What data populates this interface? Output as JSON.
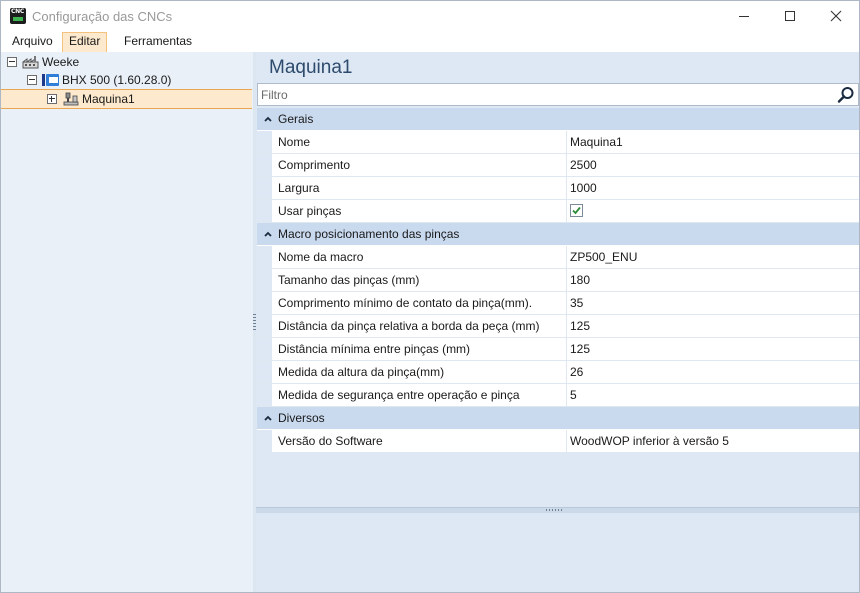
{
  "window": {
    "title": "Configuração das CNCs",
    "app_icon_text": "CNC"
  },
  "menu": {
    "items": [
      "Arquivo",
      "Editar",
      "Ferramentas"
    ],
    "active": "Editar"
  },
  "tree": {
    "nodes": [
      {
        "label": "Weeke",
        "expander": "minus"
      },
      {
        "label": "BHX 500 (1.60.28.0)",
        "expander": "minus"
      },
      {
        "label": "Maquina1",
        "expander": "plus",
        "selected": true
      }
    ]
  },
  "panel": {
    "title": "Maquina1",
    "filter_placeholder": "Filtro",
    "categories": [
      {
        "label": "Gerais",
        "props": [
          {
            "name": "Nome",
            "value": "Maquina1"
          },
          {
            "name": "Comprimento",
            "value": "2500"
          },
          {
            "name": "Largura",
            "value": "1000"
          },
          {
            "name": "Usar pinças",
            "value": "",
            "checked": true
          }
        ]
      },
      {
        "label": "Macro posicionamento das pinças",
        "props": [
          {
            "name": "Nome da macro",
            "value": "ZP500_ENU"
          },
          {
            "name": "Tamanho das pinças (mm)",
            "value": "180"
          },
          {
            "name": "Comprimento mínimo de contato da pinça(mm).",
            "value": "35"
          },
          {
            "name": "Distância da pinça relativa a borda da peça (mm)",
            "value": "125"
          },
          {
            "name": "Distância mínima entre pinças (mm)",
            "value": "125"
          },
          {
            "name": "Medida da altura da pinça(mm)",
            "value": "26"
          },
          {
            "name": "Medida de segurança entre operação e pinça",
            "value": "5"
          }
        ]
      },
      {
        "label": "Diversos",
        "props": [
          {
            "name": "Versão do Software",
            "value": "WoodWOP inferior à versão 5"
          }
        ]
      }
    ]
  },
  "colors": {
    "left_pane_bg": "#e9f0f8",
    "right_pane_bg": "#dde8f4",
    "category_bg": "#c9d9ee",
    "selection_bg": "#fde9cd",
    "selection_border": "#e8a750",
    "title_color": "#2e4a6c",
    "check_color": "#2e8b3a"
  }
}
